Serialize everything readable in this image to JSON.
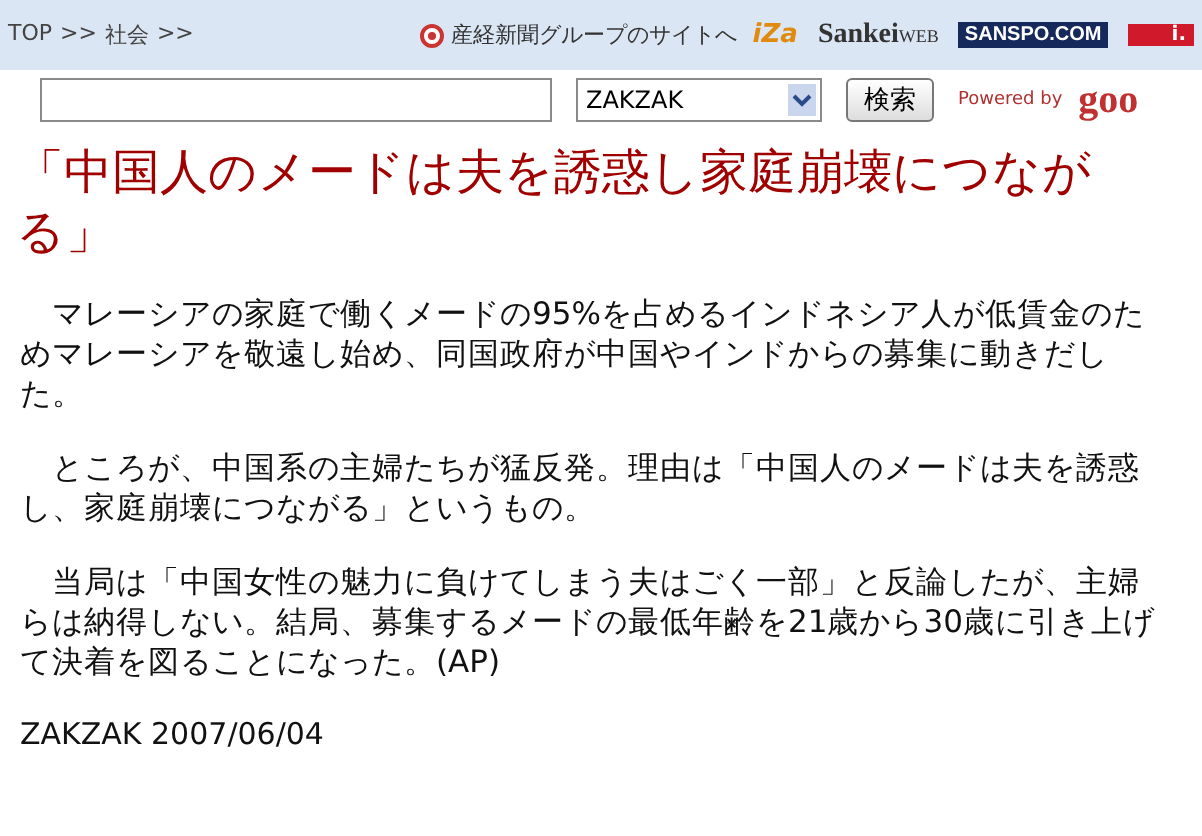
{
  "breadcrumb": [
    "TOP",
    ">>",
    "社会",
    ">>"
  ],
  "group_link": "産経新聞グループのサイトへ",
  "logos": [
    {
      "kind": "iza",
      "text": "iZa"
    },
    {
      "kind": "sankei",
      "text": "Sankei",
      "suffix": "WEB"
    },
    {
      "kind": "sanspo",
      "text": "SANSPO.COM"
    },
    {
      "kind": "business",
      "text": "i."
    }
  ],
  "search": {
    "select": "ZAKZAK",
    "button": "検索",
    "powered_by": "Powered by",
    "brand": "goo"
  },
  "headline": "「中国人のメードは夫を誘惑し家庭崩壊につながる」",
  "paragraphs": [
    "　マレーシアの家庭で働くメードの95%を占めるインドネシア人が低賃金のためマレーシアを敬遠し始め、同国政府が中国やインドからの募集に動きだした。",
    "　ところが、中国系の主婦たちが猛反発。理由は「中国人のメードは夫を誘惑し、家庭崩壊につながる」というもの。",
    "　当局は「中国女性の魅力に負けてしまう夫はごく一部」と反論したが、主婦らは納得しない。結局、募集するメードの最低年齢を21歳から30歳に引き上げて決着を図ることになった。(AP)"
  ],
  "byline": "ZAKZAK 2007/06/04"
}
